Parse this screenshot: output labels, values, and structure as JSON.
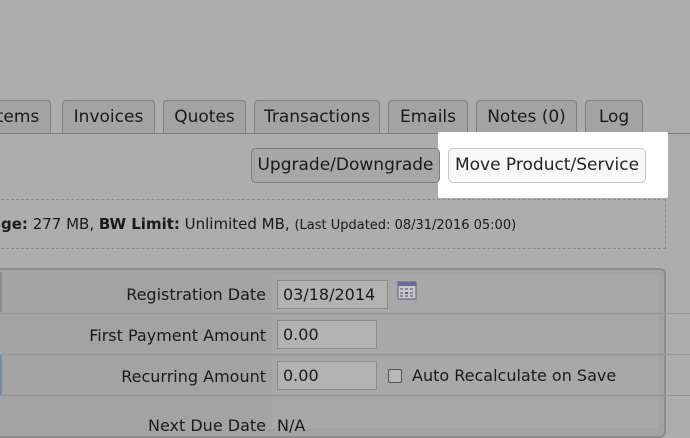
{
  "tabs": [
    {
      "label": "Items"
    },
    {
      "label": "Invoices"
    },
    {
      "label": "Quotes"
    },
    {
      "label": "Transactions"
    },
    {
      "label": "Emails"
    },
    {
      "label": "Notes (0)"
    },
    {
      "label": "Log"
    }
  ],
  "actions": {
    "upgrade_label": "Upgrade/Downgrade",
    "move_label": "Move Product/Service"
  },
  "usage": {
    "disk_label": "ge:",
    "disk_value": " 277 MB, ",
    "bw_label": "BW Limit:",
    "bw_value": " Unlimited MB, ",
    "updated": "(Last Updated: 08/31/2016 05:00)"
  },
  "form": {
    "registration_date_label": "Registration Date",
    "registration_date_value": "03/18/2014",
    "first_payment_label": "First Payment Amount",
    "first_payment_value": "0.00",
    "recurring_label": "Recurring Amount",
    "recurring_value": "0.00",
    "auto_recalc_label": "Auto Recalculate on Save",
    "next_due_label": "Next Due Date",
    "next_due_value": "N/A"
  },
  "colors": {
    "overlay": "#adadad",
    "highlight": "#ffffff"
  }
}
